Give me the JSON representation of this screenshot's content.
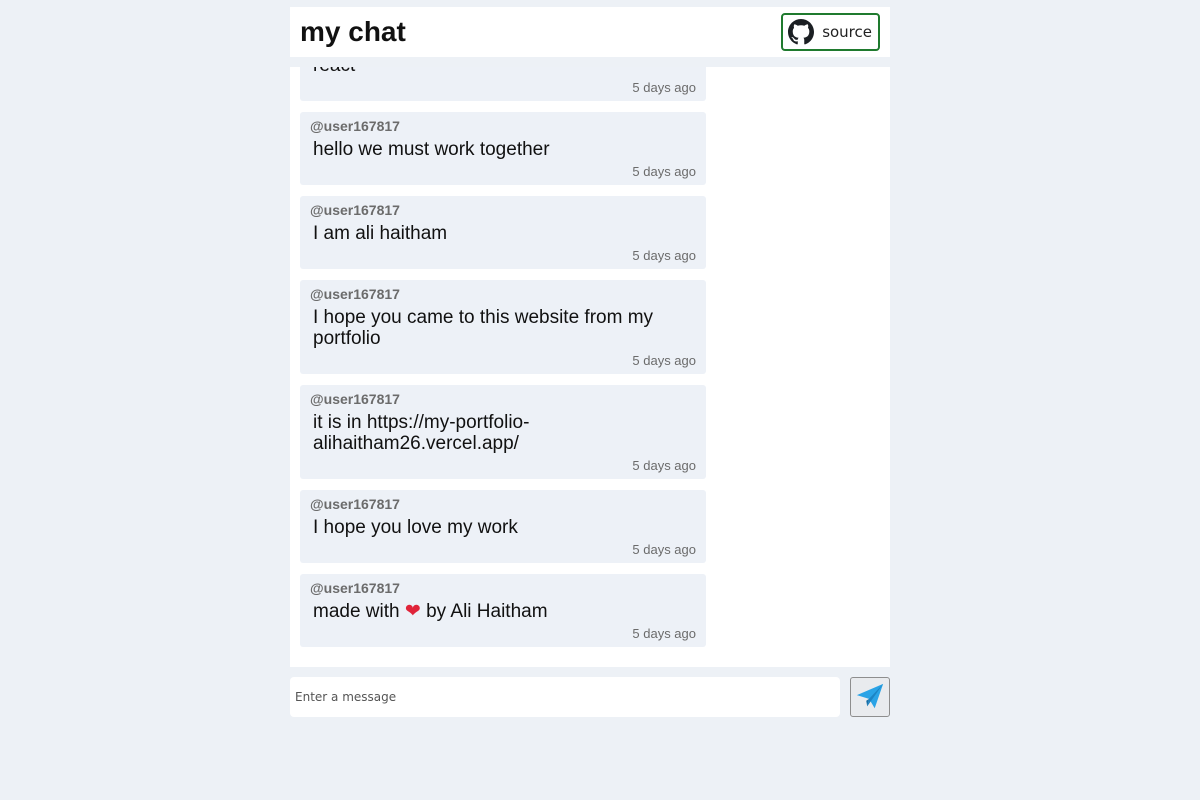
{
  "header": {
    "title": "my chat",
    "source_label": "source"
  },
  "messages": [
    {
      "user": "",
      "text": "react",
      "time": "5 days ago"
    },
    {
      "user": "@user167817",
      "text": "hello we must work together",
      "time": "5 days ago"
    },
    {
      "user": "@user167817",
      "text": "I am ali haitham",
      "time": "5 days ago"
    },
    {
      "user": "@user167817",
      "text": "I hope you came to this website from my portfolio",
      "time": "5 days ago"
    },
    {
      "user": "@user167817",
      "text": "it is in https://my-portfolio-alihaitham26.vercel.app/",
      "time": "5 days ago"
    },
    {
      "user": "@user167817",
      "text": "I hope you love my work",
      "time": "5 days ago"
    },
    {
      "user": "@user167817",
      "text_before": "made with",
      "heart": "❤",
      "text_after": "by Ali Haitham",
      "time": "5 days ago"
    }
  ],
  "composer": {
    "placeholder": "Enter a message",
    "value": ""
  },
  "icons": {
    "source": "github-icon",
    "send": "paper-plane-icon"
  },
  "colors": {
    "page_bg": "#edf1f6",
    "message_bg": "#edf1f7",
    "source_border": "#1f7a2e",
    "heart": "#e0243a",
    "send_icon": "#2aa3e6"
  }
}
